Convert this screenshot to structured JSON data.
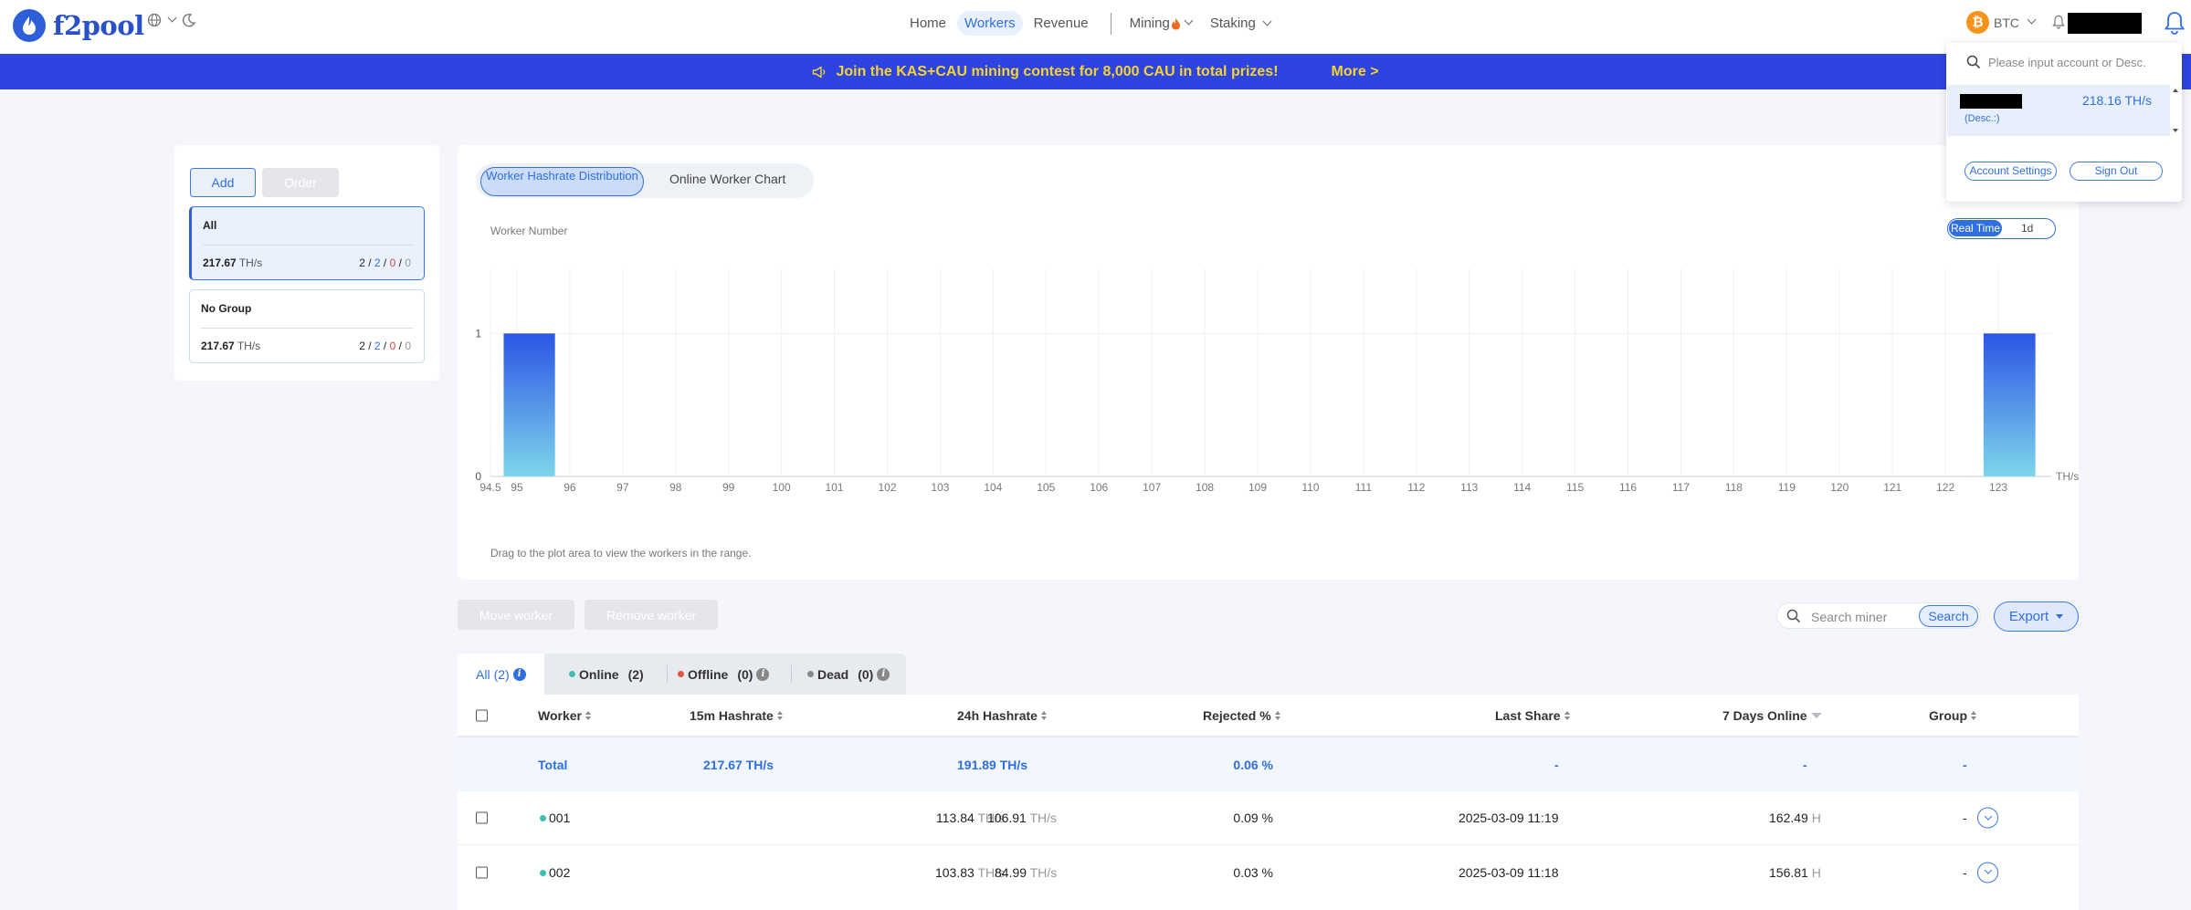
{
  "brand": {
    "name": "f2pool"
  },
  "nav": {
    "links": [
      {
        "label": "Home",
        "active": false
      },
      {
        "label": "Workers",
        "active": true
      },
      {
        "label": "Revenue",
        "active": false
      }
    ],
    "mining_label": "Mining",
    "staking_label": "Staking",
    "coin_label": "BTC"
  },
  "banner": {
    "text": "Join the KAS+CAU mining contest for 8,000 CAU in total prizes!",
    "more": "More >"
  },
  "groups": {
    "add_label": "Add",
    "order_label": "Order",
    "items": [
      {
        "name": "All",
        "hashrate": "217.67",
        "unit": "TH/s",
        "total": "2",
        "online": "2",
        "offline": "0",
        "dead": "0"
      },
      {
        "name": "No Group",
        "hashrate": "217.67",
        "unit": "TH/s",
        "total": "2",
        "online": "2",
        "offline": "0",
        "dead": "0"
      }
    ]
  },
  "chart_panel": {
    "tab_distribution": "Worker Hashrate Distribution",
    "tab_online": "Online Worker Chart",
    "range_realtime": "Real Time",
    "range_1d": "1d",
    "hint": "Drag to the plot area to view the workers in the range."
  },
  "chart_data": {
    "type": "bar",
    "title": "",
    "ylabel": "Worker Number",
    "xlabel": "TH/s",
    "x_ticks": [
      "94.5",
      "95",
      "96",
      "97",
      "98",
      "99",
      "100",
      "101",
      "102",
      "103",
      "104",
      "105",
      "106",
      "107",
      "108",
      "109",
      "110",
      "111",
      "112",
      "113",
      "114",
      "115",
      "116",
      "117",
      "118",
      "119",
      "120",
      "121",
      "122",
      "123"
    ],
    "y_ticks": [
      "0",
      "1"
    ],
    "xlim": [
      94.5,
      124
    ],
    "ylim": [
      0,
      1.2
    ],
    "bars": [
      {
        "x_start": 94.75,
        "x_end": 95.72,
        "value": 1
      },
      {
        "x_start": 122.72,
        "x_end": 123.7,
        "value": 1
      }
    ],
    "colors": {
      "top": "#2c55e6",
      "bottom": "#7dd6ea"
    },
    "grid": true
  },
  "actions": {
    "move_label": "Move worker",
    "remove_label": "Remove worker",
    "search_placeholder": "Search miner",
    "search_label": "Search",
    "export_label": "Export"
  },
  "filters": [
    {
      "label": "All",
      "count": "(2)"
    },
    {
      "label": "Online",
      "count": "(2)"
    },
    {
      "label": "Offline",
      "count": "(0)"
    },
    {
      "label": "Dead",
      "count": "(0)"
    }
  ],
  "table": {
    "headers": {
      "worker": "Worker",
      "hash15m": "15m Hashrate",
      "hash24h": "24h Hashrate",
      "rejected": "Rejected %",
      "last_share": "Last Share",
      "online7d": "7 Days Online",
      "group": "Group"
    },
    "total": {
      "label": "Total",
      "hash15m": "217.67 TH/s",
      "hash24h": "191.89 TH/s",
      "rejected": "0.06 %",
      "last_share": "-",
      "online7d": "-",
      "group": "-"
    },
    "rows": [
      {
        "worker": "001",
        "hash15m": "113.84",
        "hash24h": "106.91",
        "unit": "TH/s",
        "rejected": "0.09 %",
        "last_share": "2025-03-09 11:19",
        "online7d": "162.49",
        "hours_unit": "H",
        "group": "-"
      },
      {
        "worker": "002",
        "hash15m": "103.83",
        "hash24h": "84.99",
        "unit": "TH/s",
        "rejected": "0.03 %",
        "last_share": "2025-03-09 11:18",
        "online7d": "156.81",
        "hours_unit": "H",
        "group": "-"
      }
    ]
  },
  "account_dropdown": {
    "search_placeholder": "Please input account or Desc.",
    "hashrate": "218.16 TH/s",
    "desc": "(Desc.:)",
    "settings_label": "Account Settings",
    "signout_label": "Sign Out"
  }
}
